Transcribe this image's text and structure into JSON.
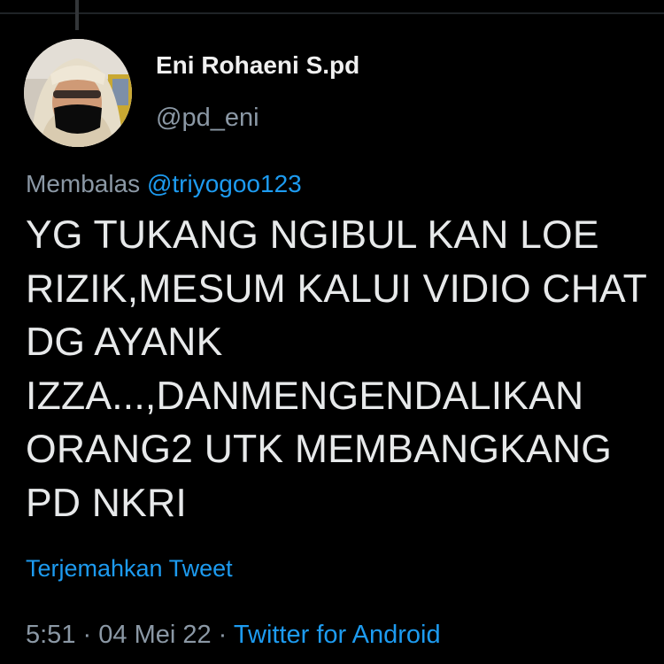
{
  "tweet": {
    "display_name": "Eni Rohaeni S.pd",
    "handle": "@pd_eni",
    "reply_prefix": "Membalas",
    "reply_to": "@triyogoo123",
    "text_lines": [
      "YG TUKANG NGIBUL KAN LOE",
      "RIZIK,MESUM KALUI VIDIO CHAT",
      "DG AYANK",
      "IZZA...,DANMENGENDALIKAN",
      "ORANG2 UTK MEMBANGKANG",
      "PD NKRI"
    ],
    "translate_label": "Terjemahkan Tweet",
    "time": "5:51",
    "separator": "·",
    "date": "04 Mei 22",
    "source": "Twitter for Android"
  },
  "colors": {
    "background": "#000000",
    "text": "#e7e9ea",
    "muted": "#8b98a5",
    "link": "#1d9bf0"
  },
  "icons": {
    "avatar": "profile-photo-woman-hijab-black-mask"
  }
}
